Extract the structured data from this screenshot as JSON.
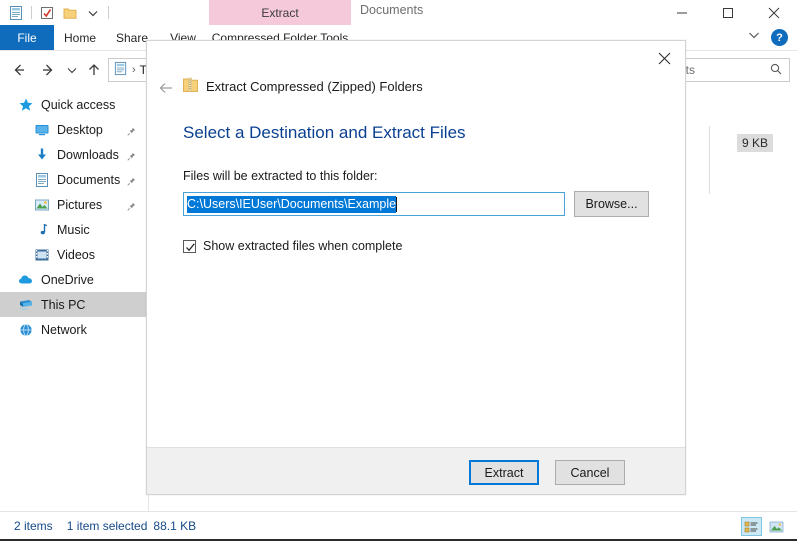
{
  "window": {
    "title": "Documents",
    "quick_access_icons": [
      "documents-icon",
      "checklist-icon",
      "folder-icon",
      "customize-chevron-icon"
    ],
    "controls": {
      "minimize": "minimize-icon",
      "maximize": "maximize-icon",
      "close": "close-icon"
    }
  },
  "ribbon": {
    "contextual_tool_header": "Extract",
    "contextual_color": "#f6c9da",
    "tabs": [
      {
        "label": "File",
        "active": true,
        "color": "#0f6cbd"
      },
      {
        "label": "Home",
        "active": false
      },
      {
        "label": "Share",
        "active": false
      },
      {
        "label": "View",
        "active": false
      },
      {
        "label": "Compressed Folder Tools",
        "active": false
      }
    ],
    "collapse_label": "chevron-down-icon",
    "help_label": "?"
  },
  "addressbar": {
    "back": "back-arrow-icon",
    "forward": "forward-arrow-icon",
    "recent": "recent-locations-icon",
    "up": "up-arrow-icon",
    "crumb_icon": "documents-icon",
    "crumb_separator": "›",
    "crumb_text": "T",
    "search_value": "nts",
    "search_icon": "search-icon"
  },
  "navpane": {
    "items": [
      {
        "label": "Quick access",
        "icon": "star-icon",
        "indent": false,
        "selected": false,
        "pinned": false
      },
      {
        "label": "Desktop",
        "icon": "desktop-icon",
        "indent": true,
        "selected": false,
        "pinned": true
      },
      {
        "label": "Downloads",
        "icon": "downloads-icon",
        "indent": true,
        "selected": false,
        "pinned": true
      },
      {
        "label": "Documents",
        "icon": "documents-icon",
        "indent": true,
        "selected": false,
        "pinned": true
      },
      {
        "label": "Pictures",
        "icon": "pictures-icon",
        "indent": true,
        "selected": false,
        "pinned": true
      },
      {
        "label": "Music",
        "icon": "music-icon",
        "indent": true,
        "selected": false,
        "pinned": false
      },
      {
        "label": "Videos",
        "icon": "videos-icon",
        "indent": true,
        "selected": false,
        "pinned": false
      },
      {
        "label": "OneDrive",
        "icon": "onedrive-icon",
        "indent": false,
        "selected": false,
        "pinned": false
      },
      {
        "label": "This PC",
        "icon": "thispc-icon",
        "indent": false,
        "selected": true,
        "pinned": false
      },
      {
        "label": "Network",
        "icon": "network-icon",
        "indent": false,
        "selected": false,
        "pinned": false
      }
    ]
  },
  "filelist": {
    "visible_size_cell": "9 KB"
  },
  "statusbar": {
    "item_count": "2 items",
    "selection": "1 item selected",
    "selection_size": "88.1 KB",
    "views": [
      {
        "name": "details-view-button",
        "icon": "details-view-icon",
        "active": true
      },
      {
        "name": "large-icons-view-button",
        "icon": "thumbnail-view-icon",
        "active": false
      }
    ]
  },
  "dialog": {
    "app_title": "Extract Compressed (Zipped) Folders",
    "app_icon": "zip-folder-icon",
    "back_icon": "back-arrow-icon",
    "close_icon": "close-icon",
    "heading": "Select a Destination and Extract Files",
    "heading_color": "#0a3f91",
    "dest_label": "Files will be extracted to this folder:",
    "path_value": "C:\\Users\\IEUser\\Documents\\Example",
    "path_selected": true,
    "selection_color": "#0078d7",
    "browse_label": "Browse...",
    "checkbox": {
      "label": "Show extracted files when complete",
      "checked": true
    },
    "buttons": {
      "extract": "Extract",
      "cancel": "Cancel",
      "default_focus": "extract"
    }
  }
}
